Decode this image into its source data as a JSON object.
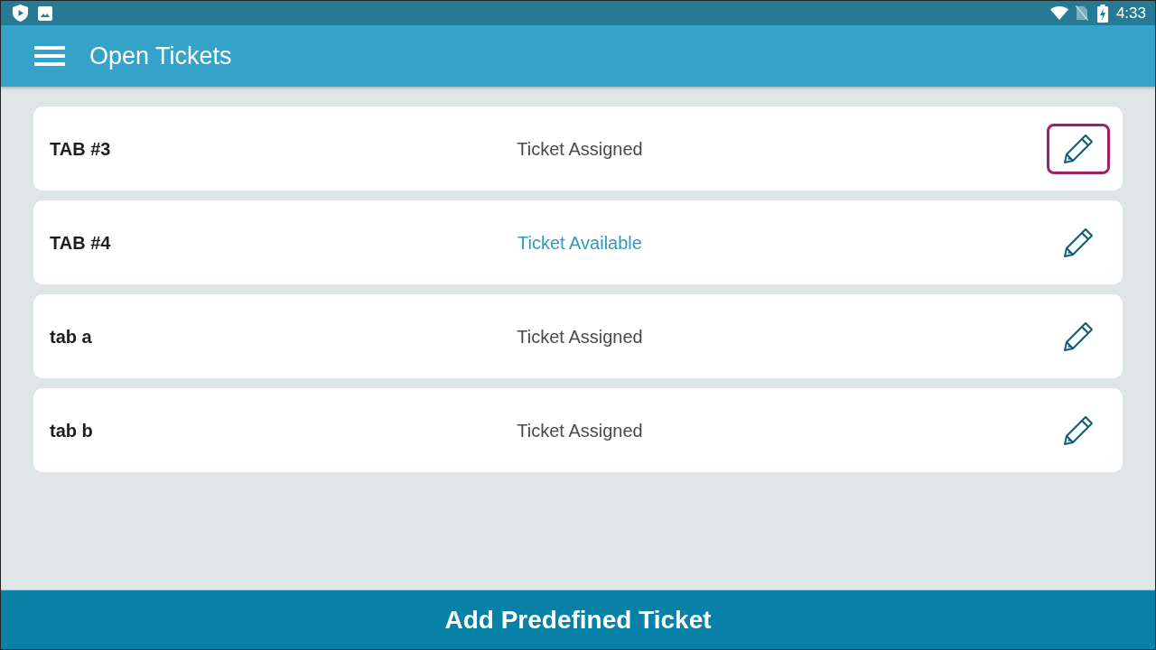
{
  "status_bar": {
    "time": "4:33"
  },
  "app_bar": {
    "title": "Open Tickets"
  },
  "tickets": [
    {
      "name": "TAB #3",
      "status": "Ticket Assigned",
      "available": false,
      "edit_focused": true
    },
    {
      "name": "TAB #4",
      "status": "Ticket Available",
      "available": true,
      "edit_focused": false
    },
    {
      "name": "tab a",
      "status": "Ticket Assigned",
      "available": false,
      "edit_focused": false
    },
    {
      "name": "tab b",
      "status": "Ticket Assigned",
      "available": false,
      "edit_focused": false
    }
  ],
  "footer_button": {
    "label": "Add Predefined Ticket"
  }
}
